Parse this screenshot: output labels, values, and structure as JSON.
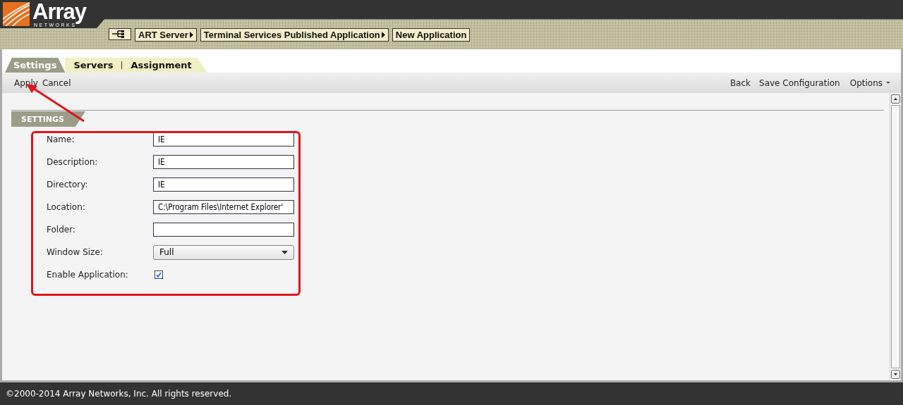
{
  "logo": {
    "name": "Array",
    "subtitle": "NETWORKS"
  },
  "breadcrumbs": [
    "ART Server",
    "Terminal Services Published Application",
    "New Application"
  ],
  "tabs": [
    {
      "label": "Settings",
      "selected": true
    },
    {
      "label": "Servers",
      "selected": false
    },
    {
      "label": "Assignment",
      "selected": false
    }
  ],
  "toolbar": {
    "left": [
      "Apply",
      "Cancel"
    ],
    "right": [
      "Back",
      "Save Configuration"
    ],
    "menu": "Options"
  },
  "section": {
    "title": "SETTINGS"
  },
  "fields": [
    {
      "kind": "text",
      "label": "Name:",
      "value": "IE"
    },
    {
      "kind": "text",
      "label": "Description:",
      "value": "IE"
    },
    {
      "kind": "text",
      "label": "Directory:",
      "value": "IE"
    },
    {
      "kind": "text",
      "label": "Location:",
      "value": "C:\\Program Files\\Internet Explorer'"
    },
    {
      "kind": "text",
      "label": "Folder:"
    },
    {
      "kind": "select",
      "label": "Window Size:",
      "value": "Full"
    },
    {
      "kind": "checkbox",
      "label": "Enable Application:",
      "checked": true
    }
  ],
  "footer": "©2000-2014 Array Networks, Inc. All rights reserved."
}
